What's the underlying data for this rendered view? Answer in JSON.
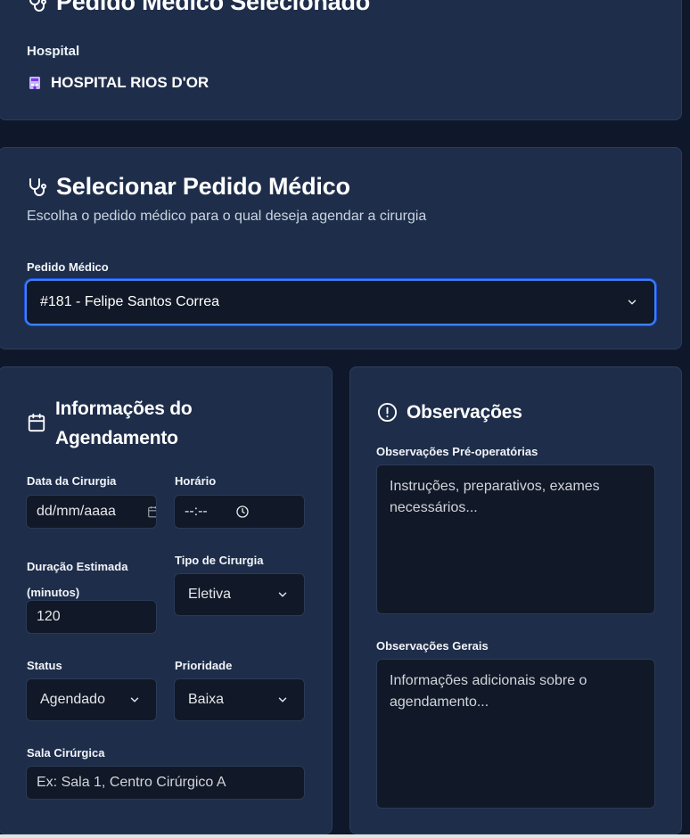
{
  "hospital_card": {
    "title": "Pedido Médico Selecionado",
    "hospital_label": "Hospital",
    "hospital_name": "HOSPITAL RIOS D'OR"
  },
  "select_card": {
    "title": "Selecionar Pedido Médico",
    "subtitle": "Escolha o pedido médico para o qual deseja agendar a cirurgia",
    "field_label": "Pedido Médico",
    "selected_value": "#181 - Felipe Santos Correa"
  },
  "info_card": {
    "title_line1": "Informações do",
    "title_line2": "Agendamento",
    "date_label": "Data da Cirurgia",
    "date_placeholder": "dd/mm/aaaa",
    "time_label": "Horário",
    "time_placeholder": "--:--",
    "duration_label_line1": "Duração Estimada",
    "duration_label_line2": "(minutos)",
    "duration_value": "120",
    "type_label": "Tipo de Cirurgia",
    "type_value": "Eletiva",
    "status_label": "Status",
    "status_value": "Agendado",
    "priority_label": "Prioridade",
    "priority_value": "Baixa",
    "room_label": "Sala Cirúrgica",
    "room_placeholder": "Ex: Sala 1, Centro Cirúrgico A"
  },
  "obs_card": {
    "title": "Observações",
    "preop_label": "Observações Pré-operatórias",
    "preop_placeholder": "Instruções, preparativos, exames necessários...",
    "general_label": "Observações Gerais",
    "general_placeholder": "Informações adicionais sobre o agendamento..."
  },
  "icons": {
    "stethoscope": "stethoscope-icon",
    "hospital": "hospital-icon",
    "calendar": "calendar-icon",
    "alert": "alert-circle-icon",
    "chevron": "chevron-down-icon",
    "clock": "clock-icon"
  }
}
